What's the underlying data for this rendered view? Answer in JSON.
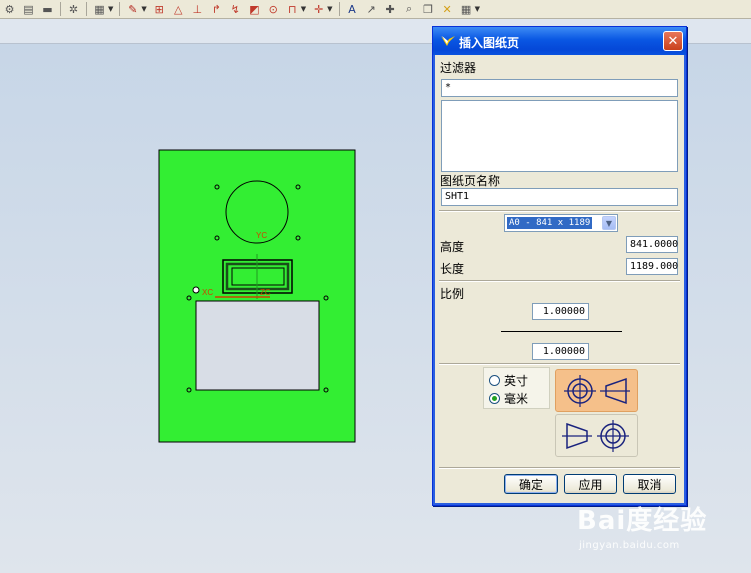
{
  "dialog": {
    "title": "插入图纸页",
    "close_glyph": "✕",
    "filter_label": "过滤器",
    "filter_value": "*",
    "sheet_name_label": "图纸页名称",
    "sheet_name_value": "SHT1",
    "size_selected": "A0 - 841 x 1189",
    "height_label": "高度",
    "height_value": "841.0000",
    "length_label": "长度",
    "length_value": "1189.000",
    "scale_label": "比例",
    "scale_numerator": "1.00000",
    "scale_denominator": "1.00000",
    "units": [
      {
        "label": "英寸",
        "checked": false
      },
      {
        "label": "毫米",
        "checked": true
      }
    ],
    "buttons": {
      "ok": "确定",
      "apply": "应用",
      "cancel": "取消"
    }
  },
  "drawing": {
    "sheet_color": "#33ee33",
    "axis_label_yc": "YC",
    "axis_label_xc": "XC",
    "axis_label_zc": "ZC"
  },
  "watermark": {
    "logo": "Bai度经验",
    "url": "jingyan.baidu.com"
  },
  "colors": {
    "titlebar": "#0a57e3",
    "accent_orange": "#f5c08a",
    "select_highlight": "#316ac5"
  }
}
